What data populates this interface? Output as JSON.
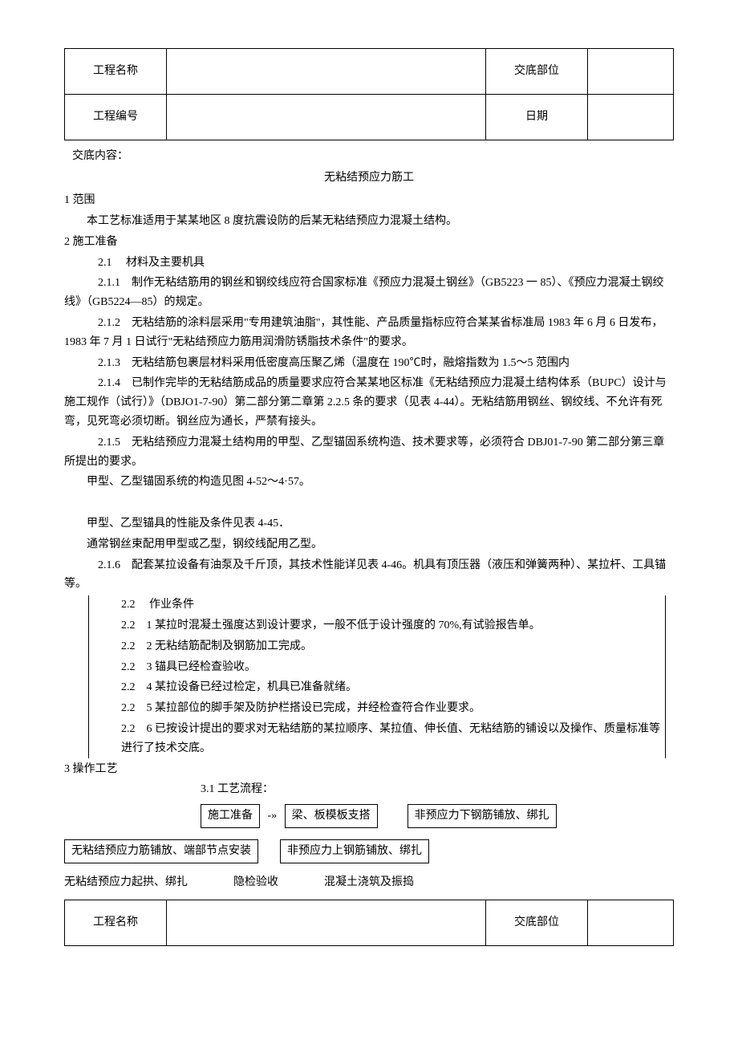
{
  "header": {
    "project_name_label": "工程名称",
    "project_name_value": "",
    "disclose_part_label": "交底部位",
    "disclose_part_value": "",
    "project_no_label": "工程编号",
    "project_no_value": "",
    "date_label": "日期",
    "date_value": ""
  },
  "intro": {
    "disclose_label": "交底内容：",
    "title": "无粘结预应力筋工"
  },
  "s1": {
    "num": "1 范围",
    "text": "本工艺标准适用于某某地区 8 度抗震设防的后某无粘结预应力混凝土结构。"
  },
  "s2": {
    "num": "2 施工准备",
    "s2_1": "2.1　 材料及主要机具",
    "s2_1_1": "2.1.1　制作无粘结筋用的钢丝和钢绞线应符合国家标准《预应力混凝土钢丝》（GB5223 一 85）、《预应力混凝土钢绞线》（GB5224—85）的规定。",
    "s2_1_2": "2.1.2　无粘结筋的涂料层采用\"专用建筑油脂\"，其性能、产品质量指标应符合某某省标准局 1983 年 6 月 6 日发布，1983 年 7 月 1 日试行\"无粘结预应力筋用润滑防锈脂技术条件\"的要求。",
    "s2_1_3": "2.1.3　无粘结筋包裹层材料采用低密度高压聚乙烯（温度在 190℃时，融熔指数为 1.5～5 范围内",
    "s2_1_4": "2.1.4　已制作完毕的无粘结筋成品的质量要求应符合某某地区标准《无粘结预应力混凝土结构体系（BUPC）设计与施工规作（试行）》（DBJO1-7-90）第二部分第二章第 2.2.5 条的要求（见表 4-44）。无粘结筋用钢丝、钢绞线、不允许有死弯，见死弯必须切断。钢丝应为通长，严禁有接头。",
    "s2_1_5": "2.1.5　无粘结预应力混凝土结构用的甲型、乙型锚固系统构造、技术要求等，必须符合 DBJ01-7-90 第二部分第三章所提出的要求。",
    "s2_1_5a": "甲型、乙型锚固系统的构造见图 4-52～4·57。",
    "s2_1_5b": "甲型、乙型锚具的性能及条件见表 4-45．",
    "s2_1_5c": "通常钢丝束配用甲型或乙型，钢绞线配用乙型。",
    "s2_1_6": "2.1.6　配套某拉设备有油泵及千斤顶，其技术性能详见表 4-46。机具有顶压器（液压和弹簧两种）、某拉杆、工具锚等。",
    "s2_2": "2.2　 作业条件",
    "s2_2_1": "2.2　1 某拉时混凝土强度达到设计要求，一般不低于设计强度的 70%,有试验报告单。",
    "s2_2_2": "2.2　2 无粘结筋配制及钢筋加工完成。",
    "s2_2_3": "2.2　3 锚具已经检查验收。",
    "s2_2_4": "2.2　4 某拉设备已经过检定，机具已准备就绪。",
    "s2_2_5": "2.2　5 某拉部位的脚手架及防护栏搭设已完成，并经检查符合作业要求。",
    "s2_2_6": "2.2　6 已按设计提出的要求对无粘结筋的某拉顺序、某拉值、伸长值、无粘结筋的铺设以及操作、质量标准等进行了技术交底。"
  },
  "s3": {
    "num": "3 操作工艺",
    "s3_1": "3.1 工艺流程：",
    "flow": {
      "b1": "施工准备",
      "arrow": "-»",
      "b2": "梁、板模板支搭",
      "b3": "非预应力下钢筋铺放、绑扎",
      "b4": "无粘结预应力筋铺放、端部节点安装",
      "b5": "非预应力上钢筋铺放、绑扎",
      "b6": "无粘结预应力起拱、绑扎",
      "b7": "隐检验收",
      "b8": "混凝土浇筑及振捣"
    }
  },
  "footer": {
    "project_name_label": "工程名称",
    "disclose_part_label": "交底部位"
  }
}
